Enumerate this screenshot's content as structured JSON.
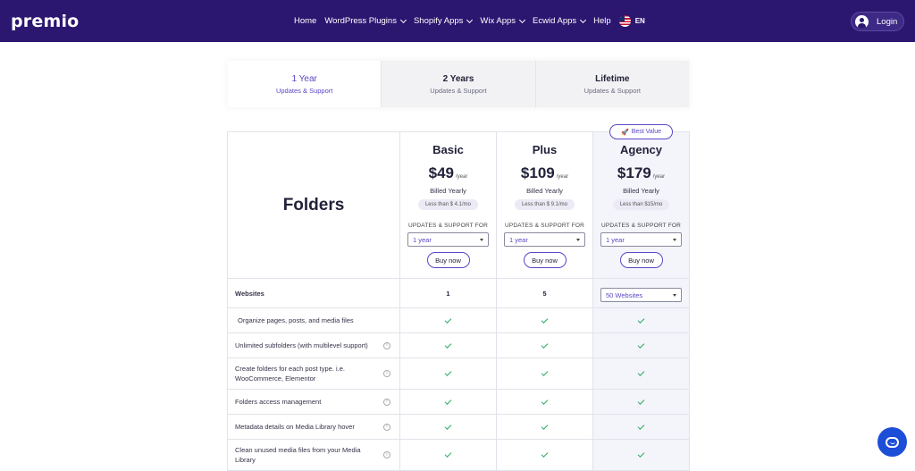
{
  "header": {
    "logo": "premio",
    "nav": [
      {
        "label": "Home",
        "dropdown": false
      },
      {
        "label": "WordPress Plugins",
        "dropdown": true
      },
      {
        "label": "Shopify Apps",
        "dropdown": true
      },
      {
        "label": "Wix Apps",
        "dropdown": true
      },
      {
        "label": "Ecwid Apps",
        "dropdown": true
      },
      {
        "label": "Help",
        "dropdown": false
      }
    ],
    "lang": "EN",
    "login": "Login"
  },
  "tabs": [
    {
      "title": "1 Year",
      "sub": "Updates & Support",
      "active": true
    },
    {
      "title": "2 Years",
      "sub": "Updates & Support",
      "active": false
    },
    {
      "title": "Lifetime",
      "sub": "Updates & Support",
      "active": false
    }
  ],
  "product": "Folders",
  "plans": [
    {
      "name": "Basic",
      "price": "$49",
      "per": "/year",
      "billed": "Billed Yearly",
      "less": "Less than $ 4.1/mo",
      "updates_label": "UPDATES & SUPPORT FOR",
      "select": "1 year",
      "buy": "Buy now"
    },
    {
      "name": "Plus",
      "price": "$109",
      "per": "/year",
      "billed": "Billed Yearly",
      "less": "Less than $ 9.1/mo",
      "updates_label": "UPDATES & SUPPORT FOR",
      "select": "1 year",
      "buy": "Buy now"
    },
    {
      "name": "Agency",
      "price": "$179",
      "per": "/year",
      "billed": "Billed Yearly",
      "less": "Less than $15/mo",
      "updates_label": "UPDATES & SUPPORT FOR",
      "select": "1 year",
      "buy": "Buy now",
      "badge": "Best Value"
    }
  ],
  "websites": {
    "label": "Websites",
    "basic": "1",
    "plus": "5",
    "agency": "50 Websites"
  },
  "features": [
    {
      "label": "Organize pages, posts, and media files",
      "info": false
    },
    {
      "label": "Unlimited subfolders (with multilevel support)",
      "info": true
    },
    {
      "label": "Create folders for each post type. i.e. WooCommerce, Elementor",
      "info": true
    },
    {
      "label": "Folders access management",
      "info": true
    },
    {
      "label": "Metadata details on Media Library hover",
      "info": true
    },
    {
      "label": "Clean unused media files from your Media Library",
      "info": true
    }
  ],
  "icons": {
    "check": "check-icon",
    "info": "info-icon",
    "chat": "chat-bubble-icon",
    "rocket": "rocket-icon"
  },
  "colors": {
    "header_bg": "#2b1670",
    "accent": "#5b47c7",
    "check": "#27ae60",
    "chat": "#1d4ed8"
  }
}
